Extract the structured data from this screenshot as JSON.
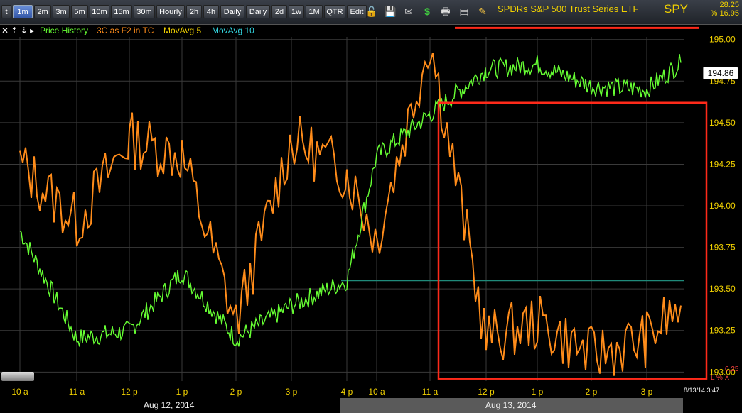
{
  "toolbar": {
    "timeframes": [
      "t",
      "1m",
      "2m",
      "3m",
      "5m",
      "10m",
      "15m",
      "30m",
      "Hourly",
      "2h",
      "4h",
      "Daily",
      "Daily",
      "2d",
      "1w",
      "1M",
      "QTR",
      "Edit"
    ],
    "active_timeframe": "1m",
    "icons": [
      "lock-icon",
      "save-icon",
      "mail-icon",
      "dollar-icon",
      "print-icon",
      "id-card-icon",
      "pencil-icon"
    ],
    "symbol_title": "SPDRs S&P 500 Trust Series ETF",
    "symbol": "SPY",
    "change": "28.25",
    "change_pct": "% 16.95"
  },
  "legend": {
    "controls": "✕ ⇡ ⇣ ▸",
    "items": [
      {
        "label": "Price History",
        "color": "#66ff33"
      },
      {
        "label": "3C as F2 in TC",
        "color": "#ff8c1a"
      },
      {
        "label": "MovAvg 5",
        "color": "#f0d000"
      },
      {
        "label": "MovAvg 10",
        "color": "#33d6e0"
      }
    ]
  },
  "price_axis": {
    "ticks": [
      "195.00",
      "194.75",
      "194.50",
      "194.25",
      "194.00",
      "193.75",
      "193.50",
      "193.25",
      "193.00"
    ],
    "last_price": "194.86"
  },
  "time_axis": {
    "ticks": [
      "10 a",
      "11 a",
      "12 p",
      "1 p",
      "2 p",
      "3 p",
      "4 p",
      "10 a",
      "11 a",
      "12 p",
      "1 p",
      "2 p",
      "3 p"
    ]
  },
  "dates": {
    "day1": "Aug 12, 2014",
    "day2": "Aug 13, 2014"
  },
  "status": {
    "scale_value": "0.25",
    "scale_mode": "L % X",
    "timestamp": "8/13/14 3:47"
  },
  "colors": {
    "price": "#66ff33",
    "indicator": "#ff8c1a",
    "annotation": "#ff2a1a",
    "prev_close_line": "#1f8a7a",
    "grid": "#3a3a3a"
  },
  "chart_data": {
    "type": "line",
    "series": [
      {
        "name": "Price History",
        "x": [
          "10 a",
          "11 a",
          "12 p",
          "1 p",
          "2 p",
          "3 p",
          "4 p",
          "10 a",
          "11 a",
          "12 p",
          "1 p",
          "2 p",
          "3 p",
          "3:47 p"
        ],
        "values": [
          193.85,
          193.2,
          193.25,
          193.6,
          193.2,
          193.4,
          193.55,
          194.3,
          194.55,
          194.82,
          194.85,
          194.72,
          194.7,
          194.86
        ]
      },
      {
        "name": "3C as F2 in TC",
        "x": [
          "10 a",
          "11 a",
          "12 p",
          "1 p",
          "2 p",
          "3 p",
          "4 p",
          "10 a",
          "11 a",
          "12 p",
          "1 p",
          "2 p",
          "3 p",
          "3:47 p"
        ],
        "values": [
          194.25,
          193.9,
          194.4,
          194.3,
          193.3,
          194.4,
          194.2,
          193.8,
          195.0,
          193.2,
          193.3,
          193.1,
          193.2,
          193.4
        ]
      }
    ],
    "ylim": [
      192.98,
      195.05
    ],
    "grid": true,
    "annotations": [
      {
        "kind": "horizontal-line",
        "y": 195.07,
        "from_x": "11 a",
        "color": "#ff2a1a"
      },
      {
        "kind": "box",
        "y_range": [
          192.96,
          194.62
        ],
        "from_x": "11 a",
        "color": "#ff2a1a"
      }
    ]
  }
}
